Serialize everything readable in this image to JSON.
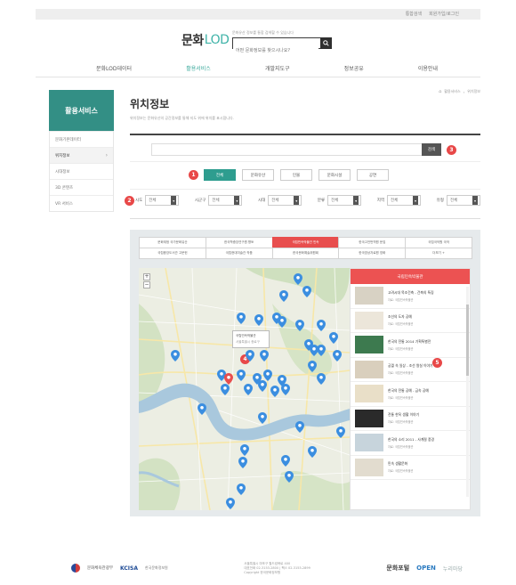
{
  "top_links": [
    "통합검색",
    "회원가입/로그인"
  ],
  "header": {
    "logo_main": "문화",
    "logo_sub": "LOD",
    "search_hint": "문화유산 정보를 통합 검색할 수 있습니다",
    "search_placeholder": "어떤 문화정보를 찾으시나요?"
  },
  "gnb": [
    "문화LOD데이터",
    "활용서비스",
    "개발지도구",
    "정보공유",
    "이용안내"
  ],
  "sidebar": {
    "title": "활용서비스",
    "items": [
      "문화기본데이터",
      "위치정보",
      "시대정보",
      "3D 콘텐츠",
      "VR 서비스"
    ]
  },
  "page": {
    "title": "위치정보",
    "description": "위치정보는 문화유산의 공간정보를 통해 지도 위에 위치를 표시합니다.",
    "breadcrumb": [
      "홈",
      "활용서비스",
      "위치정보"
    ]
  },
  "search": {
    "keyword_placeholder": "",
    "button_label": "검색",
    "categories": [
      "전체",
      "문화유산",
      "인물",
      "문화시설",
      "공연"
    ],
    "filters": [
      {
        "label": "시도",
        "value": "전체"
      },
      {
        "label": "시군구",
        "value": "전체"
      },
      {
        "label": "시대",
        "value": "전체"
      },
      {
        "label": "분류",
        "value": "전체"
      },
      {
        "label": "지역",
        "value": "전체"
      },
      {
        "label": "유형",
        "value": "전체"
      }
    ]
  },
  "badges": [
    "1",
    "2",
    "3",
    "4",
    "5"
  ],
  "source_tabs": [
    "문화재청 국가문화유산",
    "한국학중앙연구원 향토",
    "국립민속박물관 민속",
    "한국고전번역원 문집",
    "국립국악원 국악",
    "국립중앙도서관 고문헌",
    "국립현대미술관 작품",
    "한국문화예술위원회",
    "한국영상자료원 영화",
    "더보기 +"
  ],
  "active_source_tab": 2,
  "map": {
    "info_title": "국립민속박물관",
    "info_sub": "서울특별시 종로구"
  },
  "list_panel": {
    "title": "국립민속박물관",
    "items": [
      {
        "title": "고려시대 목조건축 - 건축의 특징",
        "sub": "자료: 국립민속박물관"
      },
      {
        "title": "조선의 도자 공예",
        "sub": "자료: 국립민속박물관"
      },
      {
        "title": "한국의 전통 2014 기획특별전",
        "sub": "자료: 국립민속박물관"
      },
      {
        "title": "궁궐 속 일상 - 조선 왕실 이야기",
        "sub": "자료: 국립민속박물관"
      },
      {
        "title": "한국의 전통 공예 - 금속 공예",
        "sub": "자료: 국립민속박물관"
      },
      {
        "title": "전통 한옥 생활 이야기",
        "sub": "자료: 국립민속박물관"
      },
      {
        "title": "한국의 소리 2011 - 사계절 풍경",
        "sub": "자료: 국립민속박물관"
      },
      {
        "title": "민속 생활문화",
        "sub": "자료: 국립민속박물관"
      }
    ]
  },
  "footer": {
    "org1": "문화체육관광부",
    "org2": "KCISA",
    "org2_sub": "한국문화정보원",
    "address": "서울특별시 마포구 월드컵북로 400",
    "contact": "대표전화 02-3153-2800 | 팩스 02-3153-2899",
    "copyright": "Copyright 한국문화정보원",
    "right_logo1": "문화포털",
    "right_logo2": "OPEN",
    "right_logo3": "누리마당"
  },
  "colors": {
    "accent": "#2e9d8f",
    "sidebar": "#338f85",
    "red": "#e84e4e",
    "pin": "#3b8ee0"
  }
}
